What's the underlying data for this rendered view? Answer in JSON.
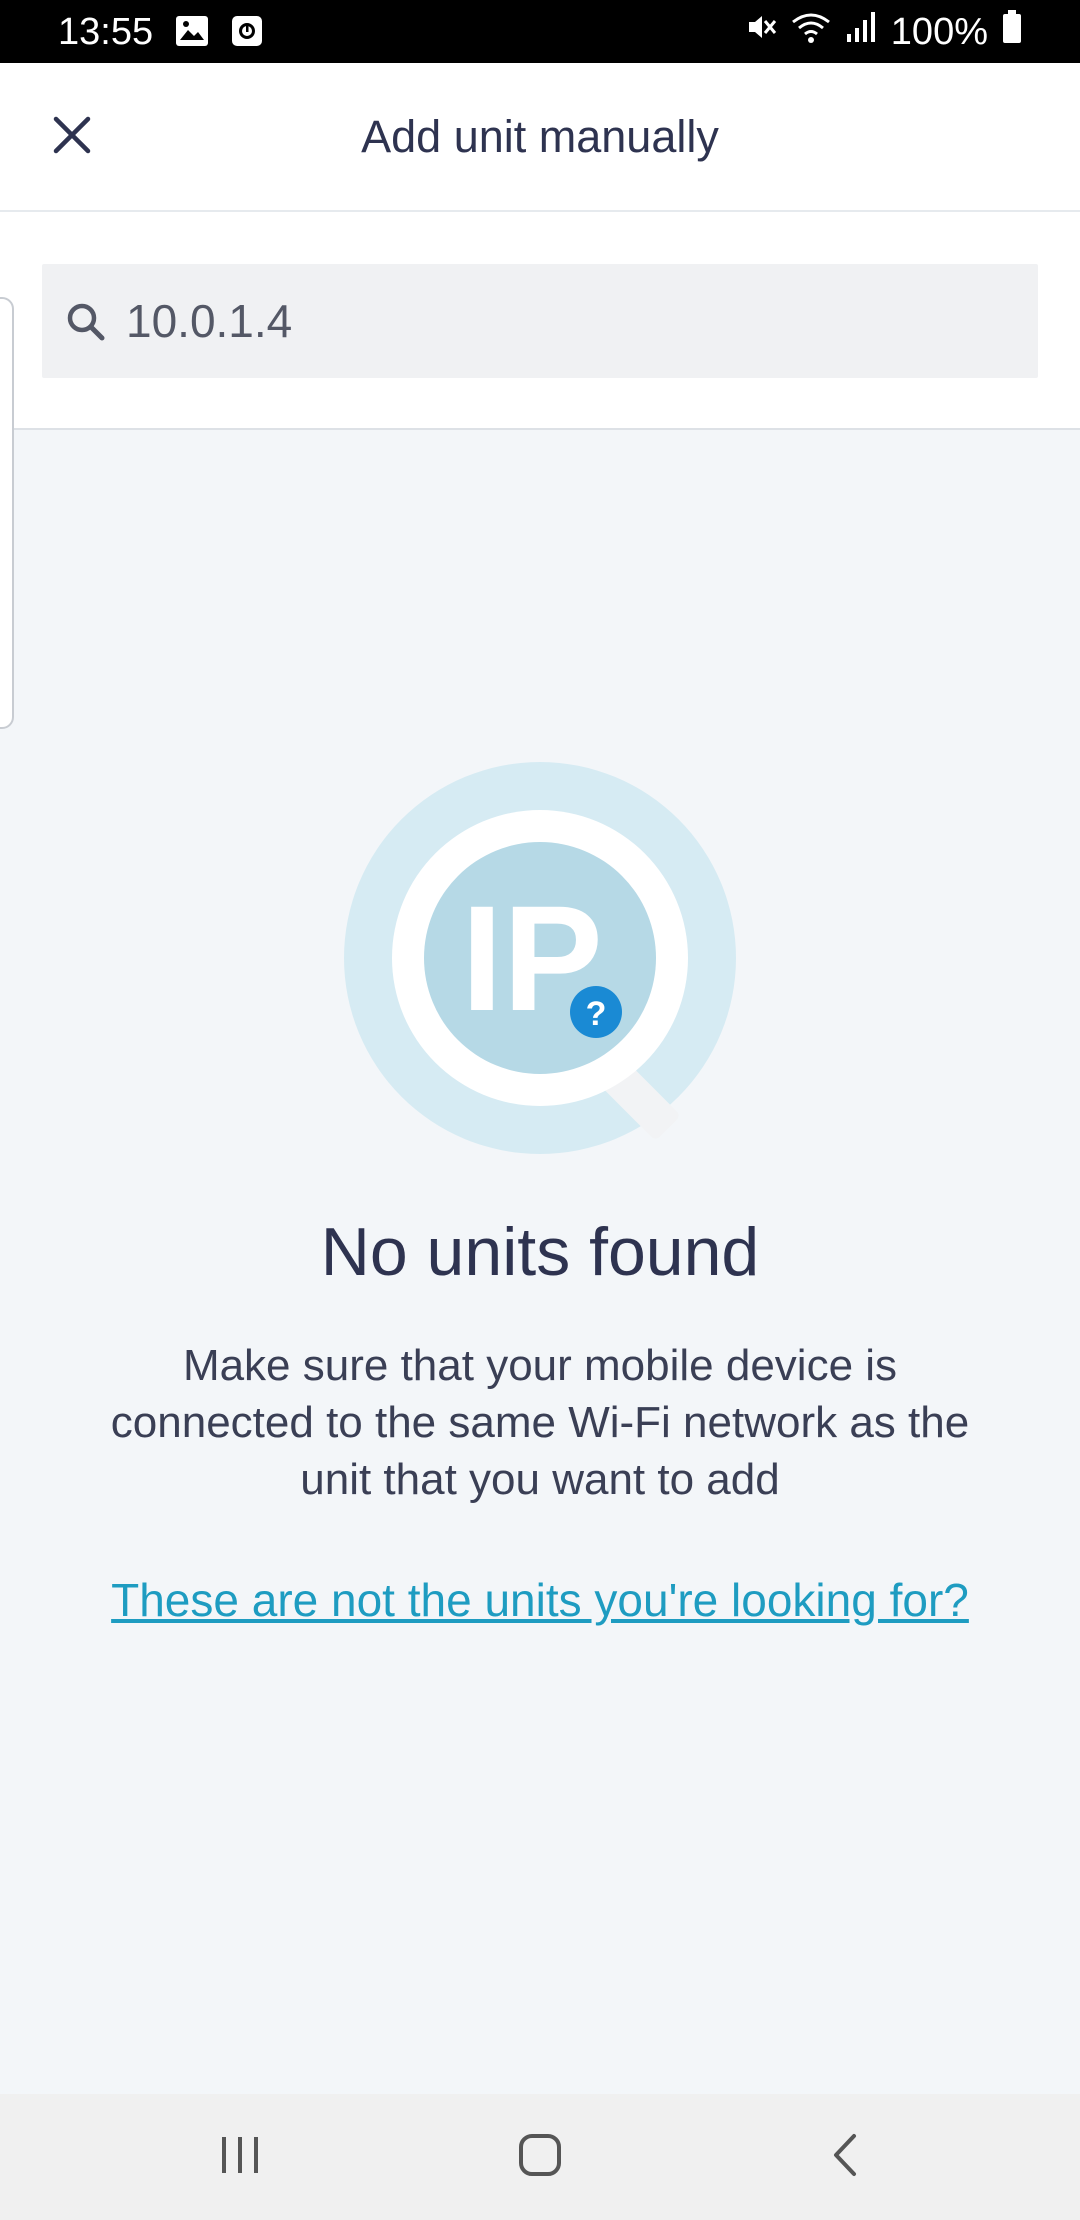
{
  "status_bar": {
    "time": "13:55",
    "battery": "100%",
    "icons": [
      "image-icon",
      "screen-record-icon",
      "mute-icon",
      "wifi-icon",
      "signal-icon",
      "battery-icon"
    ]
  },
  "header": {
    "title": "Add unit manually",
    "close_icon": "close-icon"
  },
  "search": {
    "value": "10.0.1.4",
    "icon": "search-icon"
  },
  "empty_state": {
    "illustration_icon": "ip-search-icon",
    "illustration_text": "IP",
    "badge_text": "?",
    "title": "No units found",
    "message": "Make sure that your mobile device is connected to the same Wi-Fi network as the unit that you want to add",
    "link": "These are not the units you're looking for?"
  },
  "nav_bar": {
    "icons": [
      "recent-apps-icon",
      "home-icon",
      "back-icon"
    ]
  },
  "colors": {
    "accent_link": "#1e9cc1",
    "badge_blue": "#1a8ad4",
    "text_dark": "#2e3350",
    "background": "#f3f6f9"
  }
}
